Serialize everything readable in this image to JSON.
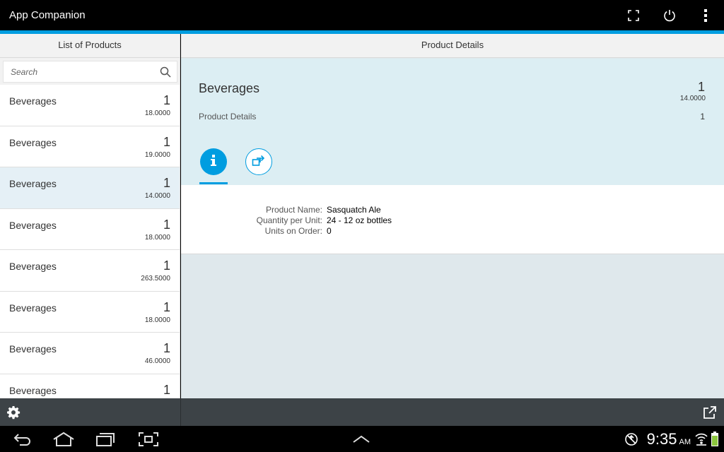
{
  "app": {
    "title": "App Companion"
  },
  "colors": {
    "accent": "#009de0",
    "footer": "#3d4347",
    "selected_row": "#e5f0f6",
    "object_header": "#dceef3",
    "battery": "#8cc63f"
  },
  "master": {
    "header": "List of Products",
    "search_placeholder": "Search",
    "items": [
      {
        "title": "Beverages",
        "number": "1",
        "sub": "18.0000",
        "selected": false
      },
      {
        "title": "Beverages",
        "number": "1",
        "sub": "19.0000",
        "selected": false
      },
      {
        "title": "Beverages",
        "number": "1",
        "sub": "14.0000",
        "selected": true
      },
      {
        "title": "Beverages",
        "number": "1",
        "sub": "18.0000",
        "selected": false
      },
      {
        "title": "Beverages",
        "number": "1",
        "sub": "263.5000",
        "selected": false
      },
      {
        "title": "Beverages",
        "number": "1",
        "sub": "18.0000",
        "selected": false
      },
      {
        "title": "Beverages",
        "number": "1",
        "sub": "46.0000",
        "selected": false
      },
      {
        "title": "Beverages",
        "number": "1",
        "sub": "",
        "selected": false
      }
    ]
  },
  "detail": {
    "header": "Product Details",
    "object": {
      "title": "Beverages",
      "number": "1",
      "number_sub": "14.0000",
      "attribute": "Product Details",
      "attribute_value": "1"
    },
    "tabs": [
      {
        "icon": "info-icon",
        "selected": true
      },
      {
        "icon": "navigate-icon",
        "selected": false
      }
    ],
    "form": [
      {
        "label": "Product Name:",
        "value": "Sasquatch Ale"
      },
      {
        "label": "Quantity per Unit:",
        "value": "24 - 12 oz bottles"
      },
      {
        "label": "Units on Order:",
        "value": "0"
      }
    ]
  },
  "status": {
    "time": "9:35",
    "ampm": "AM"
  }
}
